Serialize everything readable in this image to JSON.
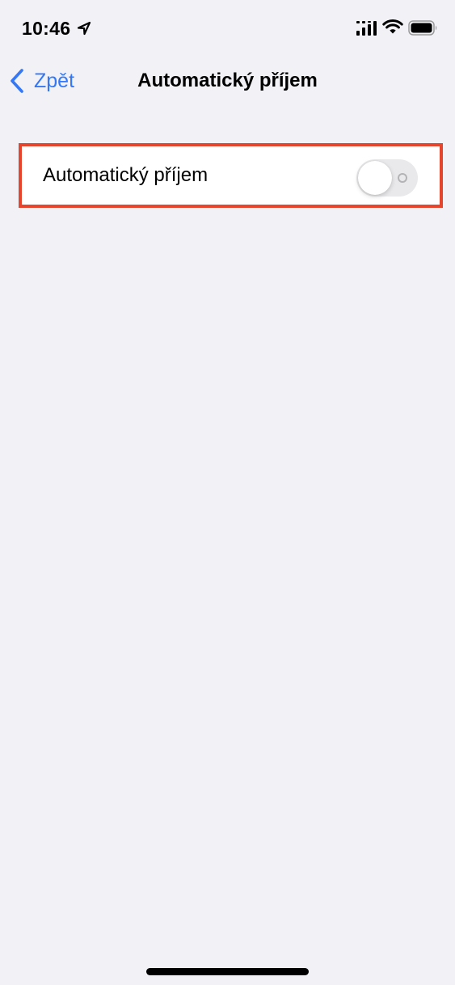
{
  "status_bar": {
    "time": "10:46",
    "icons": [
      "location-arrow-icon",
      "cellular-signal-icon",
      "wifi-icon",
      "battery-icon"
    ]
  },
  "nav": {
    "back_label": "Zpět",
    "title": "Automatický příjem"
  },
  "settings": {
    "auto_receive": {
      "label": "Automatický příjem",
      "enabled": false
    }
  },
  "colors": {
    "accent": "#3478f6",
    "background": "#f2f1f6",
    "highlight": "#e5452d",
    "toggle_off": "#e9e9eb"
  }
}
